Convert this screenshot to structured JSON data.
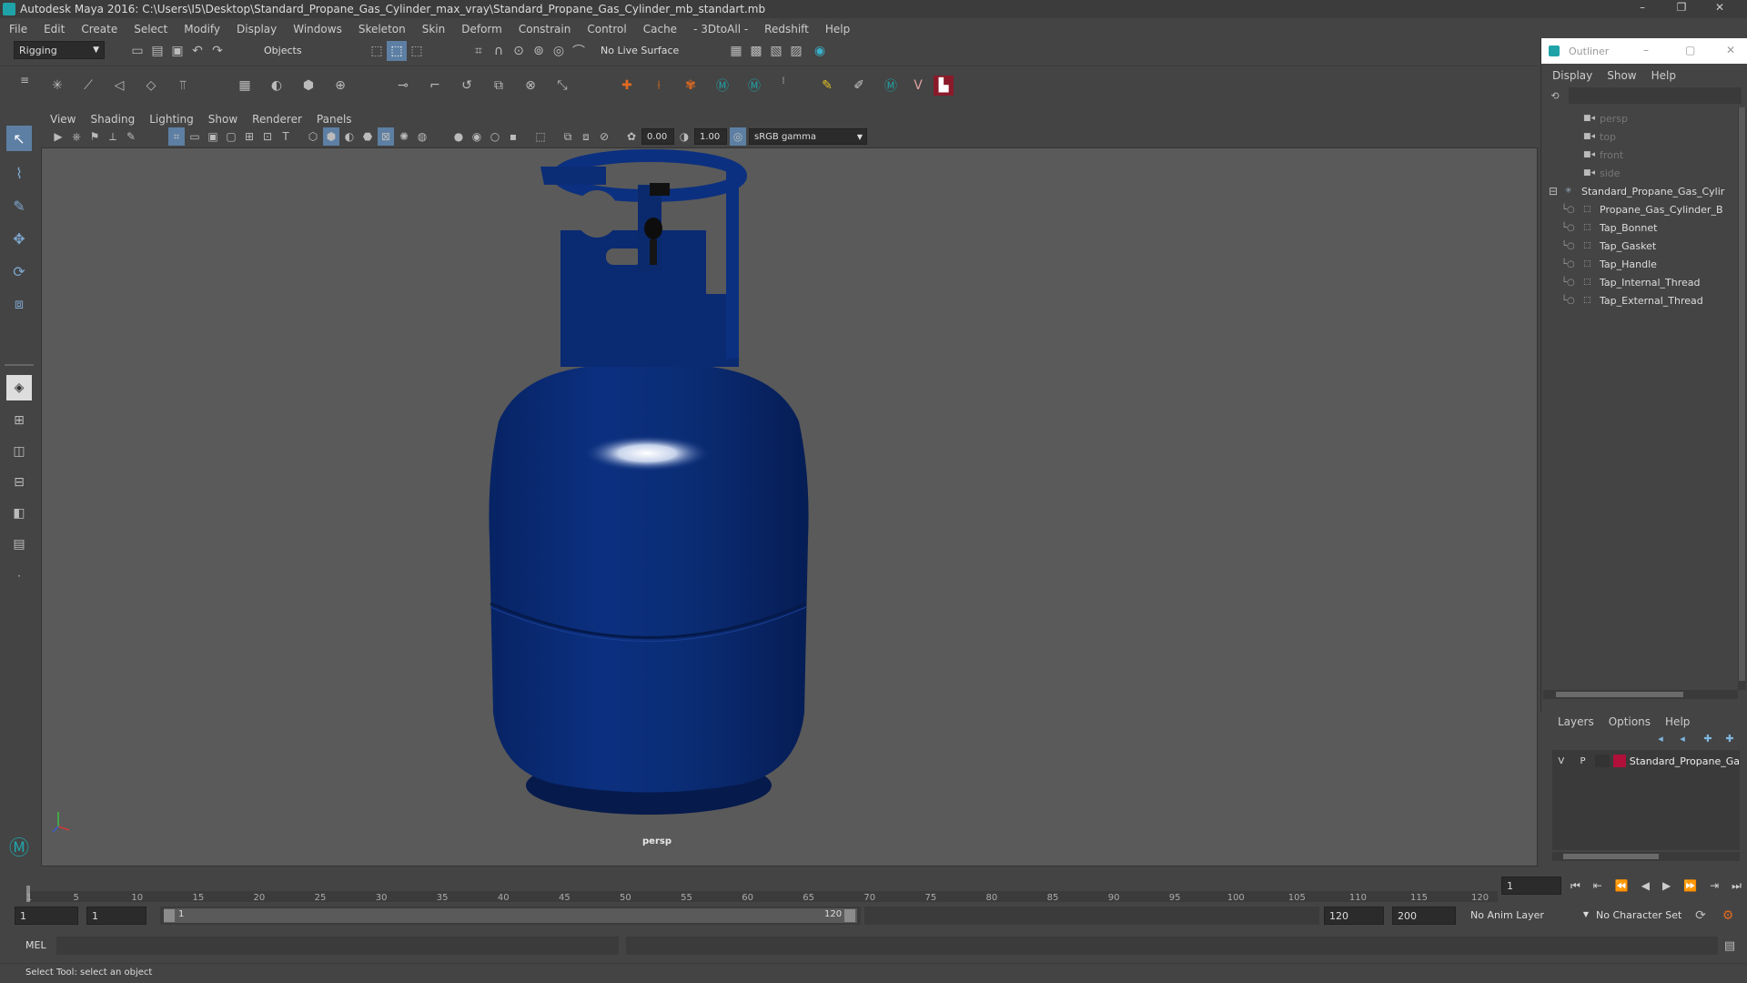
{
  "window": {
    "title": "Autodesk Maya 2016: C:\\Users\\I5\\Desktop\\Standard_Propane_Gas_Cylinder_max_vray\\Standard_Propane_Gas_Cylinder_mb_standart.mb",
    "controls": [
      "–",
      "❐",
      "✕"
    ]
  },
  "menubar": [
    "File",
    "Edit",
    "Create",
    "Select",
    "Modify",
    "Display",
    "Windows",
    "Skeleton",
    "Skin",
    "Deform",
    "Constrain",
    "Control",
    "Cache",
    "- 3DtoAll -",
    "Redshift",
    "Help"
  ],
  "statusline": {
    "menuset": "Rigging",
    "selection_mode": "Objects",
    "live_surface": "No Live Surface"
  },
  "viewport": {
    "menus": [
      "View",
      "Shading",
      "Lighting",
      "Show",
      "Renderer",
      "Panels"
    ],
    "exposure": "0.00",
    "gamma": "1.00",
    "color_space": "sRGB gamma",
    "camera_label": "persp",
    "accent_color": "#0b2d73"
  },
  "outliner": {
    "title": "Outliner",
    "menus": [
      "Display",
      "Show",
      "Help"
    ],
    "items": [
      {
        "label": "persp",
        "type": "camera"
      },
      {
        "label": "top",
        "type": "camera"
      },
      {
        "label": "front",
        "type": "camera"
      },
      {
        "label": "side",
        "type": "camera"
      },
      {
        "label": "Standard_Propane_Gas_Cylir",
        "type": "group"
      },
      {
        "label": "Propane_Gas_Cylinder_B",
        "type": "mesh"
      },
      {
        "label": "Tap_Bonnet",
        "type": "mesh"
      },
      {
        "label": "Tap_Gasket",
        "type": "mesh"
      },
      {
        "label": "Tap_Handle",
        "type": "mesh"
      },
      {
        "label": "Tap_Internal_Thread",
        "type": "mesh"
      },
      {
        "label": "Tap_External_Thread",
        "type": "mesh"
      }
    ]
  },
  "layers": {
    "menus": [
      "Layers",
      "Options",
      "Help"
    ],
    "row": {
      "v": "V",
      "p": "P",
      "name": "Standard_Propane_Ga",
      "color": "#b0103a"
    }
  },
  "timeline": {
    "ticks": [
      1,
      5,
      10,
      15,
      20,
      25,
      30,
      35,
      40,
      45,
      50,
      55,
      60,
      65,
      70,
      75,
      80,
      85,
      90,
      95,
      100,
      105,
      110,
      115,
      120
    ],
    "current_frame": "1"
  },
  "range": {
    "start": "1",
    "playback_start": "1",
    "slider_start": "1",
    "slider_end": "120",
    "playback_end": "120",
    "end": "200",
    "anim_layer": "No Anim Layer",
    "character_set": "No Character Set"
  },
  "command": {
    "lang": "MEL"
  },
  "helpline": "Select Tool: select an object"
}
